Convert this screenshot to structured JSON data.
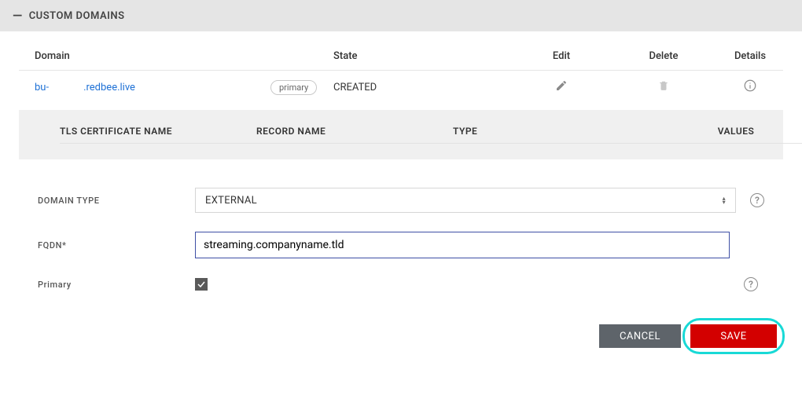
{
  "header": {
    "title": "CUSTOM DOMAINS"
  },
  "table": {
    "columns": {
      "domain": "Domain",
      "state": "State",
      "edit": "Edit",
      "delete": "Delete",
      "details": "Details"
    },
    "row": {
      "domain_prefix": "bu-",
      "domain_suffix": ".redbee.live",
      "badge": "primary",
      "state": "CREATED"
    }
  },
  "subtable": {
    "tls": "TLS CERTIFICATE NAME",
    "record": "RECORD NAME",
    "type": "TYPE",
    "values": "VALUES"
  },
  "form": {
    "domain_type_label": "DOMAIN TYPE",
    "domain_type_value": "EXTERNAL",
    "fqdn_label": "FQDN*",
    "fqdn_value": "streaming.companyname.tld",
    "primary_label": "Primary",
    "primary_checked": true
  },
  "actions": {
    "cancel": "CANCEL",
    "save": "SAVE"
  }
}
